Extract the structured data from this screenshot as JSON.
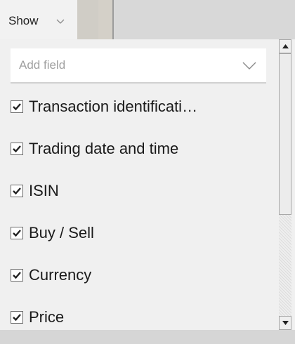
{
  "header": {
    "show_label": "Show",
    "show_icon": "chevron-down-icon"
  },
  "field_picker": {
    "placeholder": "Add field",
    "value": "",
    "icon": "chevron-down-icon"
  },
  "fields": [
    {
      "label": "Transaction identificati…",
      "checked": true
    },
    {
      "label": "Trading date and time",
      "checked": true
    },
    {
      "label": "ISIN",
      "checked": true
    },
    {
      "label": "Buy / Sell",
      "checked": true
    },
    {
      "label": "Currency",
      "checked": true
    },
    {
      "label": "Price",
      "checked": true
    }
  ],
  "colors": {
    "panel_bg": "#f0f0f0",
    "checkbox_border": "#6b6b6b",
    "check_mark": "#222222"
  }
}
